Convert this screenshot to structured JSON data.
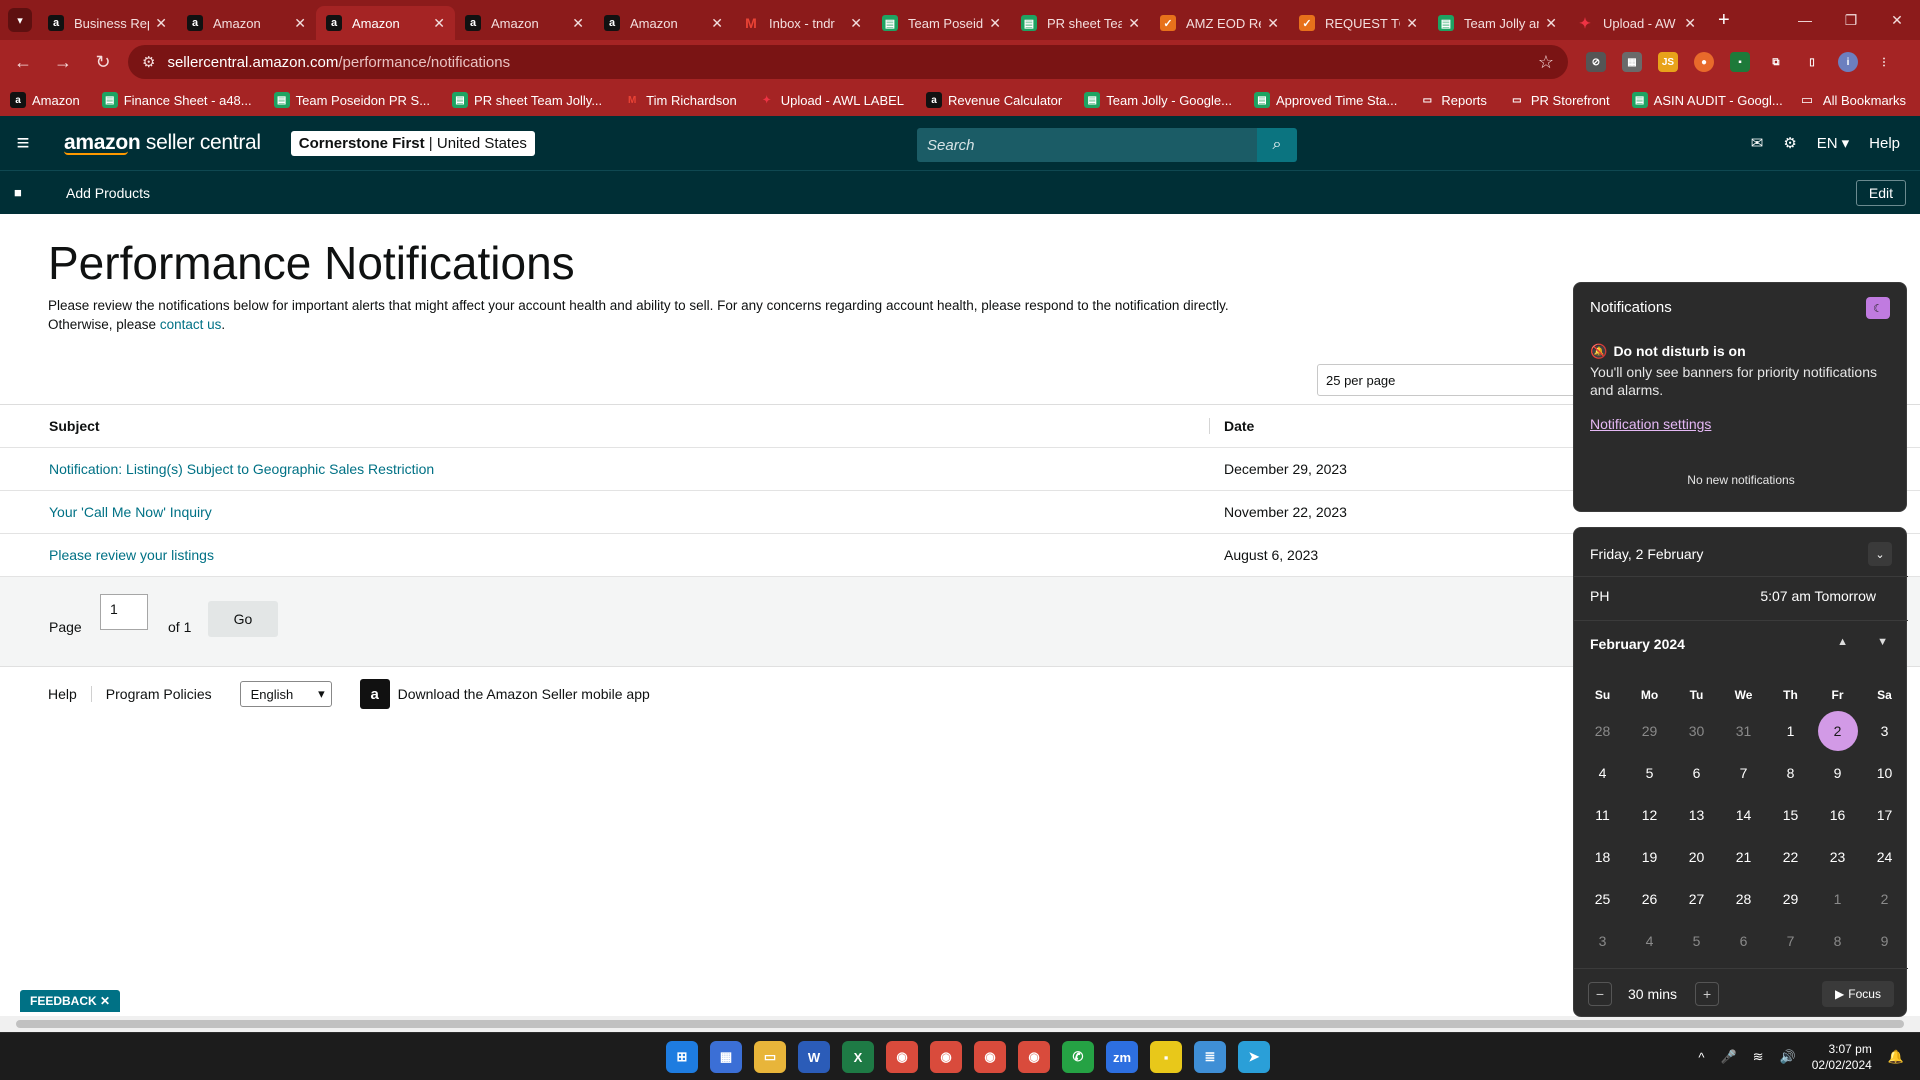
{
  "browser": {
    "tabs": [
      {
        "title": "Business Rep",
        "favicon": "amazon-icon",
        "active": false
      },
      {
        "title": "Amazon",
        "favicon": "amazon-icon",
        "active": false
      },
      {
        "title": "Amazon",
        "favicon": "amazon-icon",
        "active": true
      },
      {
        "title": "Amazon",
        "favicon": "amazon-icon",
        "active": false
      },
      {
        "title": "Amazon",
        "favicon": "amazon-icon",
        "active": false
      },
      {
        "title": "Inbox - tndr",
        "favicon": "gmail-icon",
        "active": false
      },
      {
        "title": "Team Poseid",
        "favicon": "sheets-icon",
        "active": false
      },
      {
        "title": "PR sheet Tea",
        "favicon": "sheets-icon",
        "active": false
      },
      {
        "title": "AMZ EOD Re",
        "favicon": "clickup-icon",
        "active": false
      },
      {
        "title": "REQUEST TO",
        "favicon": "clickup-icon",
        "active": false
      },
      {
        "title": "Team Jolly ar",
        "favicon": "sheets-icon",
        "active": false
      },
      {
        "title": "Upload - AW",
        "favicon": "awl-icon",
        "active": false
      }
    ],
    "url_host": "sellercentral.amazon.com",
    "url_path": "/performance/notifications",
    "bookmarks": [
      {
        "label": "Amazon",
        "icon": "amazon-icon"
      },
      {
        "label": "Finance Sheet - a48...",
        "icon": "sheets-icon"
      },
      {
        "label": "Team Poseidon PR S...",
        "icon": "sheets-icon"
      },
      {
        "label": "PR sheet Team Jolly...",
        "icon": "sheets-icon"
      },
      {
        "label": "Tim Richardson",
        "icon": "gmail-icon"
      },
      {
        "label": "Upload - AWL LABEL",
        "icon": "awl-icon"
      },
      {
        "label": "Revenue Calculator",
        "icon": "amazon-icon"
      },
      {
        "label": "Team Jolly - Google...",
        "icon": "sheets-icon"
      },
      {
        "label": "Approved Time Sta...",
        "icon": "sheets-icon"
      },
      {
        "label": "Reports",
        "icon": "folder-icon"
      },
      {
        "label": "PR Storefront",
        "icon": "folder-icon"
      },
      {
        "label": "ASIN AUDIT - Googl...",
        "icon": "sheets-icon"
      }
    ],
    "all_bookmarks": "All Bookmarks"
  },
  "header": {
    "logo_bold": "amazon",
    "logo_rest": " seller central",
    "store_name": "Cornerstone First",
    "store_region": "United States",
    "search_placeholder": "Search",
    "lang": "EN",
    "help": "Help",
    "sub_nav_item": "Add Products",
    "edit": "Edit"
  },
  "main": {
    "title": "Performance Notifications",
    "intro_text": "Please review the notifications below for important alerts that might affect your account health and ability to sell. For any concerns regarding account health, please respond to the notification directly. Otherwise, please ",
    "intro_link": "contact us",
    "intro_end": ".",
    "per_page": "25 per page",
    "table": {
      "col_subject": "Subject",
      "col_date": "Date",
      "rows": [
        {
          "subject": "Notification: Listing(s) Subject to Geographic Sales Restriction",
          "date": "December 29, 2023"
        },
        {
          "subject": "Your 'Call Me Now' Inquiry",
          "date": "November 22, 2023"
        },
        {
          "subject": "Please review your listings",
          "date": "August 6, 2023"
        }
      ]
    },
    "pager": {
      "page_label": "Page",
      "page_value": "1",
      "of_label": "of 1",
      "go": "Go"
    }
  },
  "footer": {
    "help": "Help",
    "policies": "Program Policies",
    "language": "English",
    "app_text": "Download the Amazon Seller mobile app",
    "feedback": "FEEDBACK"
  },
  "notification_center": {
    "title": "Notifications",
    "dnd_title": "Do not disturb is on",
    "dnd_text": "You'll only see banners for priority notifications and alarms.",
    "settings_link": "Notification settings",
    "empty": "No new notifications"
  },
  "calendar": {
    "date_header": "Friday, 2 February",
    "tz_label": "PH",
    "tz_time": "5:07 am Tomorrow",
    "month": "February 2024",
    "weekdays": [
      "Su",
      "Mo",
      "Tu",
      "We",
      "Th",
      "Fr",
      "Sa"
    ],
    "days": [
      {
        "d": "28",
        "dim": true
      },
      {
        "d": "29",
        "dim": true
      },
      {
        "d": "30",
        "dim": true
      },
      {
        "d": "31",
        "dim": true
      },
      {
        "d": "1"
      },
      {
        "d": "2",
        "today": true
      },
      {
        "d": "3"
      },
      {
        "d": "4"
      },
      {
        "d": "5"
      },
      {
        "d": "6"
      },
      {
        "d": "7"
      },
      {
        "d": "8"
      },
      {
        "d": "9"
      },
      {
        "d": "10"
      },
      {
        "d": "11"
      },
      {
        "d": "12"
      },
      {
        "d": "13"
      },
      {
        "d": "14"
      },
      {
        "d": "15"
      },
      {
        "d": "16"
      },
      {
        "d": "17"
      },
      {
        "d": "18"
      },
      {
        "d": "19"
      },
      {
        "d": "20"
      },
      {
        "d": "21"
      },
      {
        "d": "22"
      },
      {
        "d": "23"
      },
      {
        "d": "24"
      },
      {
        "d": "25"
      },
      {
        "d": "26"
      },
      {
        "d": "27"
      },
      {
        "d": "28"
      },
      {
        "d": "29"
      },
      {
        "d": "1",
        "dim": true
      },
      {
        "d": "2",
        "dim": true
      },
      {
        "d": "3",
        "dim": true
      },
      {
        "d": "4",
        "dim": true
      },
      {
        "d": "5",
        "dim": true
      },
      {
        "d": "6",
        "dim": true
      },
      {
        "d": "7",
        "dim": true
      },
      {
        "d": "8",
        "dim": true
      },
      {
        "d": "9",
        "dim": true
      }
    ],
    "focus_minutes": "30 mins",
    "focus_button": "Focus"
  },
  "taskbar": {
    "apps": [
      "windows-start-icon",
      "widgets-icon",
      "file-explorer-icon",
      "word-icon",
      "excel-icon",
      "chrome-icon",
      "chrome-icon",
      "chrome-icon",
      "chrome-icon",
      "whatsapp-icon",
      "zoom-icon",
      "sticky-notes-icon",
      "notepad-icon",
      "telegram-icon"
    ],
    "time": "3:07 pm",
    "date": "02/02/2024"
  },
  "colors": {
    "browser_frame": "#a52424",
    "seller_header": "#002f36",
    "link": "#007185",
    "today_highlight": "#d29ae6"
  }
}
